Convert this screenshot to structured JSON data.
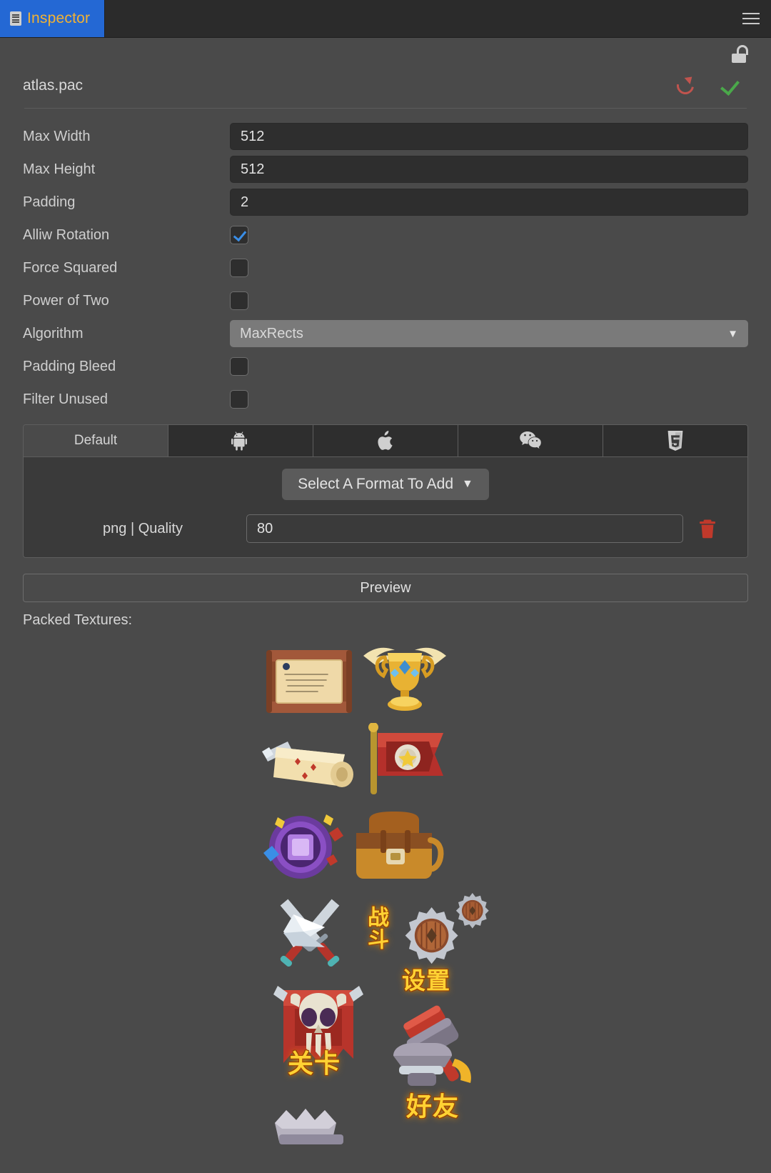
{
  "window": {
    "tab_label": "Inspector",
    "tab_icon": "inspector-icon",
    "menu_icon": "hamburger-menu-icon",
    "accent_blue": "#2468d4",
    "accent_orange": "#f2b233",
    "background": "#4a4a4a",
    "panel_background": "#2b2b2b"
  },
  "header": {
    "lock_icon": "lock-open-icon",
    "filename": "atlas.pac",
    "refresh_icon": "refresh-icon",
    "confirm_icon": "checkmark-icon",
    "refresh_color": "#c0544e",
    "confirm_color": "#4aa84a"
  },
  "properties": [
    {
      "label": "Max Width",
      "type": "text",
      "value": "512"
    },
    {
      "label": "Max Height",
      "type": "text",
      "value": "512"
    },
    {
      "label": "Padding",
      "type": "text",
      "value": "2"
    },
    {
      "label": "Alliw Rotation",
      "type": "checkbox",
      "checked": true
    },
    {
      "label": "Force Squared",
      "type": "checkbox",
      "checked": false
    },
    {
      "label": "Power of Two",
      "type": "checkbox",
      "checked": false
    },
    {
      "label": "Algorithm",
      "type": "select",
      "value": "MaxRects"
    },
    {
      "label": "Padding Bleed",
      "type": "checkbox",
      "checked": false
    },
    {
      "label": "Filter Unused",
      "type": "checkbox",
      "checked": false
    }
  ],
  "platform_tabs": [
    {
      "label": "Default",
      "icon": "default-text",
      "active": true
    },
    {
      "label": "",
      "icon": "android-icon",
      "active": false
    },
    {
      "label": "",
      "icon": "apple-icon",
      "active": false
    },
    {
      "label": "",
      "icon": "wechat-icon",
      "active": false
    },
    {
      "label": "",
      "icon": "html5-icon",
      "active": false
    }
  ],
  "format_panel": {
    "add_format_label": "Select A Format To Add",
    "add_format_caret": "▼",
    "rows": [
      {
        "label": "png | Quality",
        "value": "80",
        "delete_icon": "trash-icon"
      }
    ]
  },
  "preview": {
    "button_label": "Preview",
    "packed_textures_label": "Packed Textures:"
  },
  "textures": [
    {
      "name": "scroll-parchment-icon",
      "caption": ""
    },
    {
      "name": "winged-trophy-icon",
      "caption": ""
    },
    {
      "name": "quest-scroll-icon",
      "caption": ""
    },
    {
      "name": "red-banner-icon",
      "caption": ""
    },
    {
      "name": "purple-gem-badge-icon",
      "caption": ""
    },
    {
      "name": "leather-bag-icon",
      "caption": ""
    },
    {
      "name": "crossed-swords-icon",
      "caption": "战斗"
    },
    {
      "name": "wooden-gears-icon",
      "caption": "设置"
    },
    {
      "name": "skull-banner-icon",
      "caption": "关卡"
    },
    {
      "name": "hammer-anvil-icon",
      "caption": "好友"
    },
    {
      "name": "stone-crown-icon",
      "caption": ""
    }
  ]
}
